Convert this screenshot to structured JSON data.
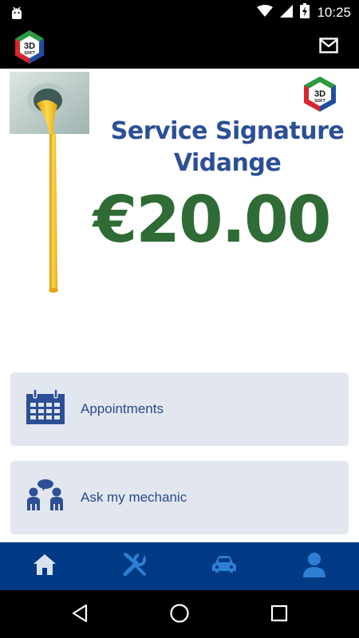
{
  "status_bar": {
    "time": "10:25",
    "icons": [
      "android-icon",
      "wifi-icon",
      "signal-icon",
      "battery-icon"
    ]
  },
  "app_bar": {
    "logo_text_top": "3D",
    "logo_text_bottom": "SOFT",
    "actions": [
      "mail-icon"
    ]
  },
  "banner": {
    "title_line1": "Service Signature",
    "title_line2": "Vidange",
    "price": "€20.00",
    "badge_text_top": "3D",
    "badge_text_bottom": "SOFT"
  },
  "cards": [
    {
      "label": "Appointments",
      "icon": "calendar-icon"
    },
    {
      "label": "Ask my mechanic",
      "icon": "chat-people-icon"
    }
  ],
  "tabs": [
    {
      "icon": "home-icon",
      "active": true
    },
    {
      "icon": "tools-icon",
      "active": false
    },
    {
      "icon": "car-icon",
      "active": false
    },
    {
      "icon": "person-icon",
      "active": false
    }
  ],
  "nav": [
    "back-icon",
    "home-circle-icon",
    "recents-icon"
  ],
  "colors": {
    "brand_blue": "#003a85",
    "title_blue": "#2c4f95",
    "price_green": "#2f6b35",
    "card_bg": "#e2e6ef",
    "tab_inactive": "#2d7fd3",
    "tab_active": "#d8e2ef"
  }
}
